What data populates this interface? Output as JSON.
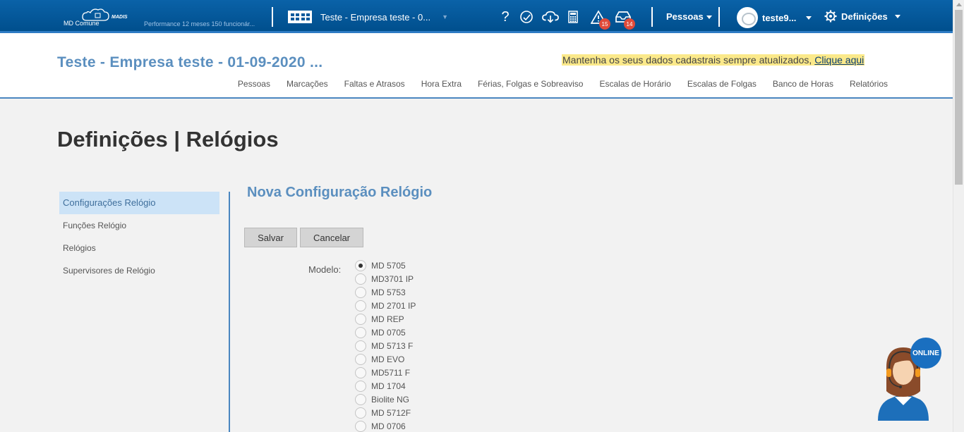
{
  "topbar": {
    "logo_text": "MD Comune",
    "logo_brand": "MADIS",
    "performance": "Performance 12 meses 150 funcionár...",
    "company_selector": "Teste - Empresa teste - 0...",
    "icons": {
      "help": "question-icon",
      "chat": "chat-icon",
      "cloud": "cloud-download-icon",
      "calculator": "calculator-icon",
      "warning": "warning-icon",
      "inbox": "inbox-icon"
    },
    "warning_count": "15",
    "inbox_count": "14",
    "pessoas_menu": "Pessoas",
    "username": "teste9...",
    "settings_menu": "Definições"
  },
  "header": {
    "company_title": "Teste - Empresa teste - 01-09-2020 ...",
    "notice_text": "Mantenha os seus dados cadastrais sempre atualizados,",
    "notice_link": "Clique aqui",
    "nav": [
      "Pessoas",
      "Marcações",
      "Faltas e Atrasos",
      "Hora Extra",
      "Férias, Folgas e Sobreaviso",
      "Escalas de Horário",
      "Escalas de Folgas",
      "Banco de Horas",
      "Relatórios"
    ]
  },
  "page": {
    "title": "Definições | Relógios",
    "sidebar": [
      "Configurações Relógio",
      "Funções Relógio",
      "Relógios",
      "Supervisores de Relógio"
    ],
    "form_title": "Nova Configuração Relógio",
    "save_label": "Salvar",
    "cancel_label": "Cancelar",
    "modelo_label": "Modelo:",
    "modelos": [
      "MD 5705",
      "MD3701 IP",
      "MD 5753",
      "MD 2701 IP",
      "MD REP",
      "MD 0705",
      "MD 5713 F",
      "MD EVO",
      "MD5711 F",
      "MD 1704",
      "Biolite NG",
      "MD 5712F",
      "MD 0706"
    ],
    "selected_modelo": "MD 5705"
  },
  "support": {
    "online_label": "ONLINE"
  },
  "colors": {
    "topbar": "#0a5a9c",
    "accent": "#5b8fbf",
    "notice_bg": "#fbe98a",
    "active_menu_bg": "#cce3f7",
    "badge": "#e04b3a"
  }
}
